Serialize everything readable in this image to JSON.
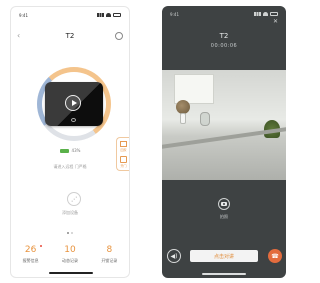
{
  "left_screen": {
    "status": {
      "time": "9:41"
    },
    "nav": {
      "back_icon": "chevron-left-icon",
      "title": "T2",
      "settings_icon": "gear-icon"
    },
    "device_card": {
      "play_icon": "play-icon"
    },
    "side_panel": {
      "home_label": "回家",
      "door_label": "开门"
    },
    "battery": {
      "value": "43%",
      "color": "#5ab14a"
    },
    "hint": "请进入远程 门严格",
    "share": {
      "icon": "share-icon",
      "label": "添加设备"
    },
    "stats": [
      {
        "value": "26",
        "label": "报警信息"
      },
      {
        "value": "10",
        "label": "动态记录"
      },
      {
        "value": "8",
        "label": "开锁记录"
      }
    ],
    "accent": "#e8933e"
  },
  "right_screen": {
    "status": {
      "time": "9:41"
    },
    "close_icon": "close-icon",
    "title": "T2",
    "timer": "00:00:06",
    "snapshot": {
      "icon": "camera-icon",
      "label": "拍照"
    },
    "speaker_icon": "speaker-icon",
    "talk_button": "点击对讲",
    "hangup_icon": "hangup-icon",
    "hangup_color": "#e36c3e"
  }
}
